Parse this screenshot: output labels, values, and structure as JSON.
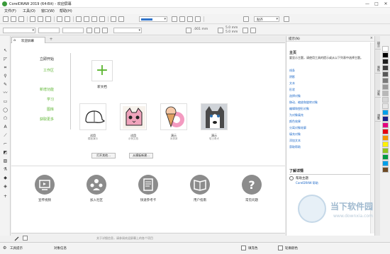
{
  "window": {
    "title": "CorelDRAW 2019 (64-Bit) - 欢迎屏幕",
    "controls": [
      "—",
      "□",
      "✕"
    ]
  },
  "menu": [
    "文件(F)",
    "工具(O)",
    "窗口(W)",
    "帮助(H)"
  ],
  "toolbar": {
    "zoom_value": "",
    "snap_label": "贴齐"
  },
  "propertybar": {
    "unit_a": ".001 mm",
    "val_a": "5.0 mm",
    "val_b": "5.0 mm"
  },
  "tab": {
    "label": "欢迎屏幕"
  },
  "welcome_nav": [
    {
      "label": "立即开始",
      "color": "#222222"
    },
    {
      "label": "工作区",
      "color": "#5cb531"
    },
    {
      "label": "新增功能",
      "color": "#5cb531"
    },
    {
      "label": "学习",
      "color": "#5cb531"
    },
    {
      "label": "图库",
      "color": "#5cb531"
    },
    {
      "label": "获取更多",
      "color": "#5cb531"
    }
  ],
  "new_doc_label": "新文档",
  "recent": [
    {
      "label": "试用",
      "sub": "模板演示"
    },
    {
      "label": "试用",
      "sub": "示例文档"
    },
    {
      "label": "演示",
      "sub": "冰淇淋"
    },
    {
      "label": "演示",
      "sub": "哈士奇犬"
    }
  ],
  "buttons": {
    "open": "打开其他...",
    "template": "从模板新建..."
  },
  "bottom_links": [
    "宣传视频",
    "加入社区",
    "快速参考卡",
    "用户指南",
    "常见问题"
  ],
  "hint_text": "关于详细信息，请参阅欢迎屏幕上的各个项目",
  "docker": {
    "title": "提示(N)",
    "heading": "主页",
    "description": "要显示主题，请使用工具的提示或从以下列表中选择主题。",
    "links": [
      "线条",
      "阴影",
      "文本",
      "形状",
      "选择对象",
      "移动、缩放和旋转对象",
      "编辑和塑形对象",
      "为对象填充",
      "颜色效果",
      "分离对象轮廓",
      "填充对象",
      "添加文本",
      "获取帮助"
    ],
    "learn_more": "了解详情",
    "learn_item": "帮助主题",
    "learn_link": "CorelDRAW 帮助"
  },
  "side_tabs": [
    "提示",
    "属性",
    "对象",
    "调整"
  ],
  "palette": [
    "#ffffff",
    "#000000",
    "#1e1e1e",
    "#3c3c3c",
    "#595959",
    "#7a7a7a",
    "#9a9a9a",
    "#b8b8b8",
    "#d6d6d6",
    "#e6e6e6",
    "#00a0e9",
    "#1d2088",
    "#e4007f",
    "#e60012",
    "#f39800",
    "#fff100",
    "#8fc31f",
    "#009944",
    "#00a0e9",
    "#6e4a24"
  ],
  "status": {
    "tool_hint": "工具提示",
    "object_info": "对象信息",
    "fill": "填充色",
    "outline": "轮廓颜色"
  },
  "watermark": {
    "text": "当下软件园",
    "url": "www.downxia.com"
  }
}
